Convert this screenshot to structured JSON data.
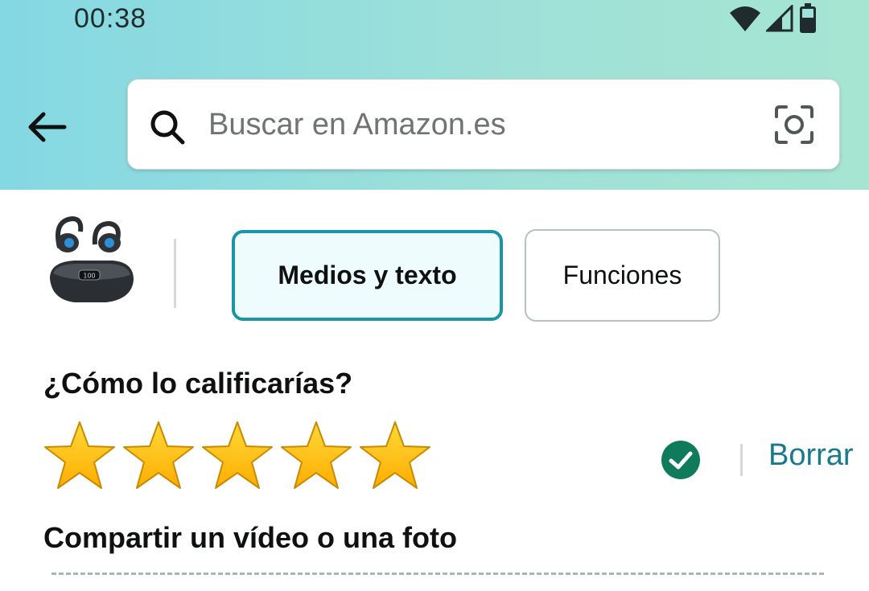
{
  "status_bar": {
    "time": "00:38",
    "icons": [
      "wifi-icon",
      "cellular-signal-icon",
      "battery-icon"
    ]
  },
  "header": {
    "back_icon": "arrow-left-icon",
    "search": {
      "placeholder": "Buscar en Amazon.es",
      "value": "",
      "left_icon": "search-icon",
      "right_icon": "camera-lens-icon"
    }
  },
  "tabs": [
    {
      "label": "Medios y texto",
      "active": true
    },
    {
      "label": "Funciones",
      "active": false
    }
  ],
  "rating": {
    "question": "¿Cómo lo calificarías?",
    "stars_total": 5,
    "stars_selected": 5,
    "confirmed_icon": "check-circle-icon",
    "clear_label": "Borrar"
  },
  "media": {
    "heading": "Compartir un vídeo o una foto"
  },
  "colors": {
    "header_gradient_start": "#84d8e3",
    "header_gradient_end": "#a6e5d1",
    "accent_teal": "#1a94a6",
    "link_teal": "#1a7a8c",
    "star_gold": "#ffc200",
    "check_green": "#0f7b5a"
  }
}
